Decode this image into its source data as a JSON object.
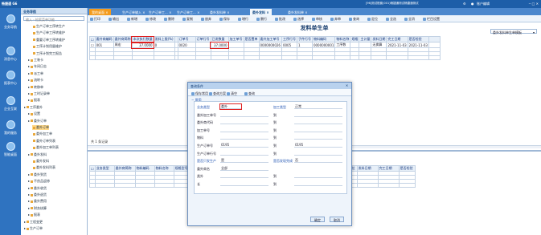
{
  "app": {
    "logo": "畅捷通 G6",
    "title_text": "[96]测试账套(001)畅捷通测试畅捷通测试",
    "user_menu": "账户编辑",
    "window_controls": [
      "─",
      "□",
      "✕"
    ]
  },
  "left_nav": [
    {
      "label": "业务导航",
      "icon": "compass-icon"
    },
    {
      "label": "消息中心",
      "icon": "mail-icon"
    },
    {
      "label": "报表中心",
      "icon": "chart-icon"
    },
    {
      "label": "企业互联",
      "icon": "link-icon"
    },
    {
      "label": "我的服务",
      "icon": "service-icon"
    },
    {
      "label": "智能桌面",
      "icon": "desktop-icon"
    }
  ],
  "tree": {
    "title": "业务导航",
    "search_placeholder": "输入 - 检索菜单功能",
    "items": [
      {
        "label": "生产订单工序转生产",
        "indent": 2
      },
      {
        "label": "生产订单工序转维护",
        "indent": 2
      },
      {
        "label": "重要订单工序转维护",
        "indent": 2
      },
      {
        "label": "工序计划用量维护",
        "indent": 2
      },
      {
        "label": "工序计划完工报告",
        "indent": 2
      },
      {
        "label": "工装卡",
        "indent": 1
      },
      {
        "label": "车间日志",
        "indent": 1
      },
      {
        "label": "派工单",
        "indent": 1
      },
      {
        "label": "流转卡",
        "indent": 1
      },
      {
        "label": "转移单",
        "indent": 1
      },
      {
        "label": "工时记录单",
        "indent": 1
      },
      {
        "label": "报表",
        "indent": 1
      },
      {
        "label": "工序委外",
        "indent": 0
      },
      {
        "label": "设置",
        "indent": 1
      },
      {
        "label": "委外订单",
        "indent": 1
      },
      {
        "label": "委外订单",
        "indent": 2,
        "selected": true
      },
      {
        "label": "委外加工单",
        "indent": 2
      },
      {
        "label": "委外订单列表",
        "indent": 2
      },
      {
        "label": "委外加工单列表",
        "indent": 2
      },
      {
        "label": "委外发料",
        "indent": 1
      },
      {
        "label": "委外发料",
        "indent": 2
      },
      {
        "label": "委外发料列表",
        "indent": 2
      },
      {
        "label": "委外到货",
        "indent": 1
      },
      {
        "label": "不良品返修",
        "indent": 1
      },
      {
        "label": "委外收货",
        "indent": 1
      },
      {
        "label": "委外退货",
        "indent": 1
      },
      {
        "label": "委外费用",
        "indent": 1
      },
      {
        "label": "财务核算",
        "indent": 1
      },
      {
        "label": "报表",
        "indent": 1
      },
      {
        "label": "工程变更",
        "indent": 0
      },
      {
        "label": "生产订单",
        "indent": 0
      }
    ]
  },
  "tabs": [
    {
      "label": "我的桌面",
      "state": "home"
    },
    {
      "label": "生产订单输入",
      "state": "normal"
    },
    {
      "label": "生产订单工...",
      "state": "normal"
    },
    {
      "label": "生产订单工...",
      "state": "normal"
    },
    {
      "label": "委外发料单",
      "state": "normal"
    },
    {
      "label": "委外发料",
      "state": "active"
    },
    {
      "label": "委外发料单",
      "state": "normal"
    }
  ],
  "toolbar": [
    {
      "label": "打印",
      "icon": "print-icon"
    },
    {
      "label": "输出",
      "icon": "export-icon"
    },
    {
      "label": "新增",
      "icon": "add-icon"
    },
    {
      "label": "修改",
      "icon": "edit-icon"
    },
    {
      "label": "删除",
      "icon": "delete-icon"
    },
    {
      "label": "复制",
      "icon": "copy-icon"
    },
    {
      "label": "放弃",
      "icon": "undo-icon"
    },
    {
      "label": "保存",
      "icon": "save-icon"
    },
    {
      "label": "增行",
      "icon": "add-row-icon"
    },
    {
      "label": "删行",
      "icon": "delete-row-icon"
    },
    {
      "label": "批改",
      "icon": "batch-edit-icon"
    },
    {
      "label": "选择",
      "icon": "select-icon"
    },
    {
      "label": "审核",
      "icon": "approve-icon"
    },
    {
      "label": "弃审",
      "icon": "unapprove-icon"
    },
    {
      "label": "查询",
      "icon": "query-icon"
    },
    {
      "label": "定位",
      "icon": "locate-icon"
    },
    {
      "label": "全选",
      "icon": "check-all-icon"
    },
    {
      "label": "全消",
      "icon": "uncheck-all-icon"
    },
    {
      "label": "栏目设置",
      "icon": "columns-icon"
    }
  ],
  "main": {
    "form_title": "发料单生单",
    "format_select": "委外发料单生单模板",
    "upper_headers": [
      "",
      "委外商编码",
      "委外商简称",
      "本次执行数量",
      "发料上限(%)",
      "",
      "订单号",
      "订单行号",
      "已发数量",
      "加工单号",
      "是否置单",
      "委外加工单号",
      "工序行号",
      "子件行号",
      "物料编码",
      "物料名称",
      "规格",
      "主计量",
      "发料日期",
      "完工日期",
      "是否检验",
      ""
    ],
    "upper_rows": [
      [
        "",
        "001",
        "周宏",
        "37.0000",
        "0",
        "",
        "0020",
        "",
        "37.0000",
        "",
        "",
        "0000000026",
        "0005",
        "1",
        "0000000001",
        "工序数",
        "",
        "",
        "无换算",
        "2021-11-03",
        "2021-11-03",
        ""
      ]
    ],
    "record_count": "共 1 条记录",
    "lower_headers": [
      "",
      "业务类型",
      "委外商简称",
      "物料编码",
      "物料名称",
      "规格型号",
      "业务员",
      "仓库",
      "委外加工单号",
      "委外加工行号",
      "工序行号",
      "工序",
      "子件行号",
      "批号",
      "主计量单位",
      "发料日期",
      "完工日期",
      "是否检验"
    ]
  },
  "dialog": {
    "title": "查询条件",
    "close": "✕",
    "toolbar": [
      {
        "label": "保存常用",
        "icon": "save-common-icon"
      },
      {
        "label": "查询方案",
        "icon": "scheme-icon"
      },
      {
        "label": "清空",
        "icon": "clear-icon"
      },
      {
        "label": "查询",
        "icon": "search-icon"
      }
    ],
    "section": "常用",
    "fields": [
      {
        "label": "业务类型",
        "link": true,
        "value": "委外"
      },
      {
        "label": "委外加工单号",
        "link": false,
        "value": ""
      },
      {
        "label": "委外商代码",
        "link": false,
        "value": ""
      },
      {
        "label": "加工单号",
        "link": false,
        "value": ""
      },
      {
        "label": "物料",
        "link": false,
        "value": ""
      },
      {
        "label": "生产订单号",
        "link": false,
        "value": "0195"
      },
      {
        "label": "生产订单行号",
        "link": false,
        "value": ""
      },
      {
        "label": "是否只发生产",
        "link": true,
        "value": "是"
      },
      {
        "label": "委外商名",
        "link": false,
        "value": "全部"
      },
      {
        "label": "类外",
        "link": false,
        "value": ""
      },
      {
        "label": "长",
        "link": false,
        "value": ""
      }
    ],
    "right_fields": [
      {
        "label": "加工类型",
        "link": true,
        "value": "正常"
      },
      {
        "label": "到",
        "link": false,
        "value": ""
      },
      {
        "label": "到",
        "link": false,
        "value": ""
      },
      {
        "label": "到",
        "link": false,
        "value": ""
      },
      {
        "label": "到",
        "link": false,
        "value": ""
      },
      {
        "label": "到",
        "link": false,
        "value": "0195"
      },
      {
        "label": "到",
        "link": false,
        "value": ""
      },
      {
        "label": "是否发现完成",
        "link": true,
        "value": "否"
      },
      {
        "label": "",
        "link": false,
        "value": ""
      },
      {
        "label": "到",
        "link": false,
        "value": ""
      },
      {
        "label": "到",
        "link": false,
        "value": ""
      }
    ],
    "ok": "确定",
    "cancel": "取消"
  },
  "colors": {
    "topbar": "#1d5ea8",
    "nav": "#2f73c0",
    "highlight_box": "#e02020",
    "tab_home": "#f39b1d"
  }
}
